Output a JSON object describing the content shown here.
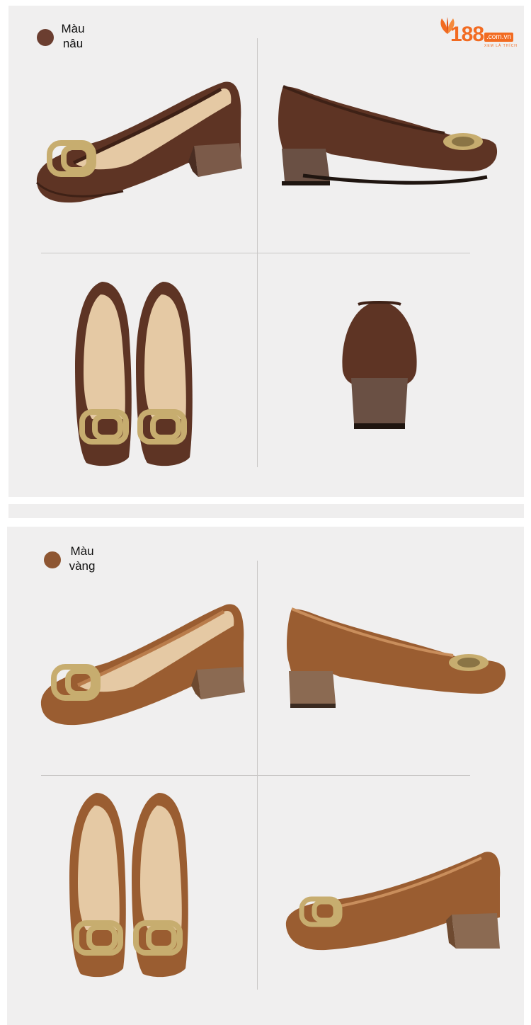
{
  "colors": {
    "brown": "#5e3424",
    "brown_dark": "#3e2116",
    "tan": "#9a5d31",
    "tan_light": "#b97c4b",
    "insole": "#e5c9a4",
    "buckle": "#c7ad6f",
    "heel_brown": "#6a5044",
    "heel_tan": "#8b6a52",
    "logo_orange": "#f26b21",
    "panel_bg": "#f0efef"
  },
  "logo": {
    "number": "188",
    "domain": ".com.vn",
    "tagline": "XEM LÀ THÍCH",
    "icon": "leaf-icon"
  },
  "variants": [
    {
      "label": "Màu\nnâu",
      "swatch": "#6b3e30"
    },
    {
      "label": "Màu\nvàng",
      "swatch": "#8e5632"
    }
  ]
}
